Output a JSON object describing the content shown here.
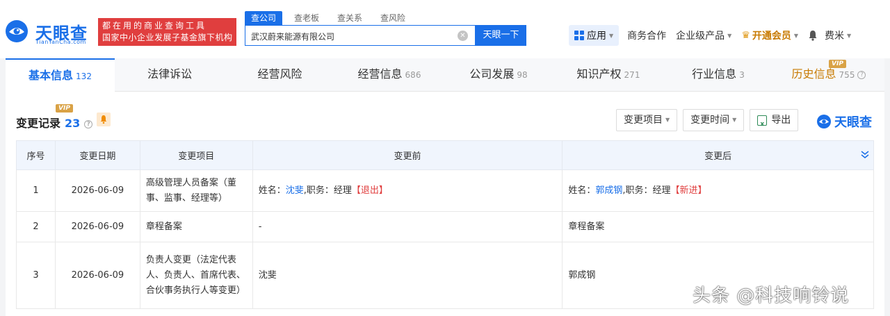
{
  "brand": {
    "name_cn": "天眼查",
    "domain": "TianYanCha.com",
    "color": "#1a6fe8"
  },
  "slogan": {
    "line1": "都在用的商业查询工具",
    "line2": "国家中小企业发展子基金旗下机构"
  },
  "search": {
    "tabs": [
      "查公司",
      "查老板",
      "查关系",
      "查风险"
    ],
    "value": "武汉蔚来能源有限公司",
    "button_label": "天眼一下"
  },
  "nav": {
    "app_label": "应用",
    "business": "商务合作",
    "enterprise": "企业级产品",
    "vip": "开通会员",
    "user": "费米"
  },
  "tabs": [
    {
      "label": "基本信息",
      "count": "132"
    },
    {
      "label": "法律诉讼",
      "count": ""
    },
    {
      "label": "经营风险",
      "count": ""
    },
    {
      "label": "经营信息",
      "count": "686"
    },
    {
      "label": "公司发展",
      "count": "98"
    },
    {
      "label": "知识产权",
      "count": "271"
    },
    {
      "label": "行业信息",
      "count": "3"
    },
    {
      "label": "历史信息",
      "count": "755"
    }
  ],
  "vip_label": "VIP",
  "section": {
    "title": "变更记录",
    "count": "23",
    "filter_item": "变更项目",
    "filter_time": "变更时间",
    "export": "导出",
    "brand_mark": "天眼查"
  },
  "table": {
    "headers": [
      "序号",
      "变更日期",
      "变更项目",
      "变更前",
      "变更后"
    ],
    "rows": [
      {
        "idx": "1",
        "date": "2026-06-09",
        "item": "高级管理人员备案（董事、监事、经理等）",
        "before": {
          "name_label": "姓名：",
          "name": "沈斐",
          "role": ",职务：经理",
          "tag": "【退出】"
        },
        "after": {
          "name_label": "姓名：",
          "name": "郭成钢",
          "role": ",职务：经理",
          "tag": "【新进】"
        }
      },
      {
        "idx": "2",
        "date": "2026-06-09",
        "item": "章程备案",
        "before": "-",
        "after": "章程备案"
      },
      {
        "idx": "3",
        "date": "2026-06-09",
        "item": "负责人变更（法定代表人、负责人、首席代表、合伙事务执行人等变更）",
        "before": "沈斐",
        "after": "郭成钢"
      }
    ]
  },
  "watermark": "头条 @科技响铃说"
}
